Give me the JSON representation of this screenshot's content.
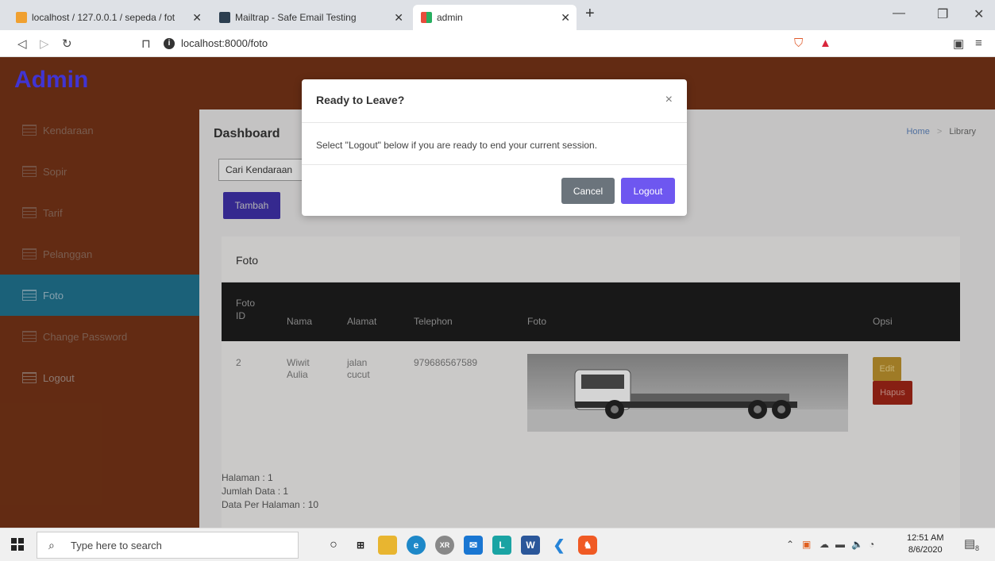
{
  "browser": {
    "tabs": [
      {
        "label": "localhost / 127.0.0.1 / sepeda / fot",
        "icon": "phpmyadmin-icon"
      },
      {
        "label": "Mailtrap - Safe Email Testing",
        "icon": "mailtrap-icon"
      },
      {
        "label": "admin",
        "icon": "admin-favicon"
      }
    ],
    "url": "localhost:8000/foto"
  },
  "app": {
    "brand": "Admin",
    "sidebar": [
      {
        "label": "Kendaraan"
      },
      {
        "label": "Sopir"
      },
      {
        "label": "Tarif"
      },
      {
        "label": "Pelanggan"
      },
      {
        "label": "Foto"
      },
      {
        "label": "Change Password"
      },
      {
        "label": "Logout"
      }
    ],
    "page_title": "Dashboard",
    "breadcrumb": {
      "home": "Home",
      "sep": ">",
      "current": "Library"
    },
    "search_placeholder": "Cari Kendaraan",
    "add_button": "Tambah",
    "card_title": "Foto",
    "table": {
      "headers": {
        "id_line1": "Foto",
        "id_line2": "ID",
        "nama": "Nama",
        "alamat": "Alamat",
        "telephon": "Telephon",
        "foto": "Foto",
        "opsi": "Opsi"
      },
      "rows": [
        {
          "id": "2",
          "nama_line1": "Wiwit",
          "nama_line2": "Aulia",
          "alamat_line1": "jalan",
          "alamat_line2": "cucut",
          "telephon": "979686567589",
          "edit": "Edit",
          "hapus": "Hapus"
        }
      ]
    },
    "pagination": {
      "halaman": "Halaman : 1",
      "jumlah": "Jumlah Data : 1",
      "per_halaman": "Data Per Halaman : 10"
    }
  },
  "modal": {
    "title": "Ready to Leave?",
    "close": "×",
    "body": "Select \"Logout\" below if you are ready to end your current session.",
    "cancel": "Cancel",
    "logout": "Logout"
  },
  "taskbar": {
    "search_placeholder": "Type here to search",
    "time": "12:51 AM",
    "date": "8/6/2020",
    "notifications": "8"
  },
  "colors": {
    "topbar": "#713216",
    "active_sidebar": "#1f6f8a",
    "brand_text": "#4a3cf0",
    "logout_button": "#6e57f0"
  }
}
